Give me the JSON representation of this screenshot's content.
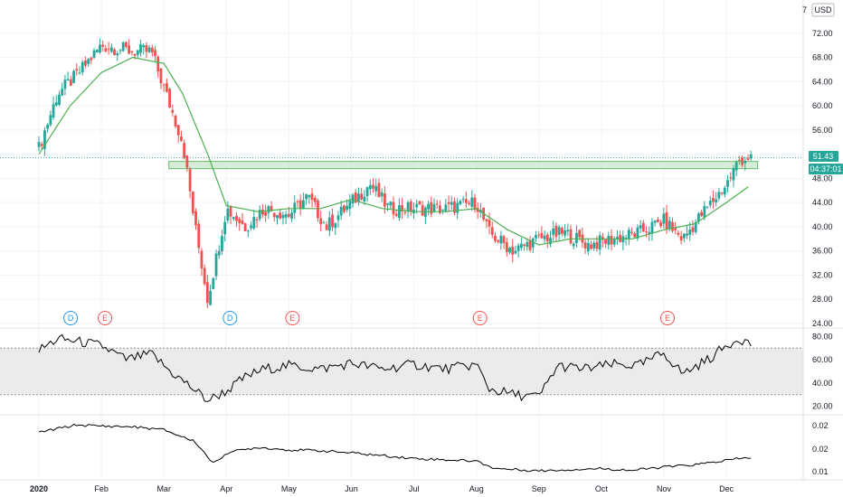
{
  "currency": "USD",
  "price_tags": {
    "last": "51.43",
    "countdown": "04:37:01"
  },
  "colors": {
    "up": "#26a69a",
    "down": "#ef5350",
    "ma": "#4caf50",
    "zone_fill": "#c8e6c9",
    "zone_stroke": "#66bb6a",
    "last_tag": "#26a69a",
    "countdown_tag": "#26a69a",
    "dividend": "#2196f3",
    "earnings": "#ef5350",
    "rsi_band": "#ebebeb",
    "osc_line": "#000000",
    "grid": "#f0f3fa"
  },
  "x_axis_labels": [
    "2020",
    "Feb",
    "Mar",
    "Apr",
    "May",
    "Jun",
    "Jul",
    "Aug",
    "Sep",
    "Oct",
    "Nov",
    "Dec"
  ],
  "events": [
    {
      "label": "D",
      "kind": "dividend",
      "month": 0.45
    },
    {
      "label": "E",
      "kind": "earnings",
      "month": 1.0
    },
    {
      "label": "D",
      "kind": "dividend",
      "month": 3.0
    },
    {
      "label": "E",
      "kind": "earnings",
      "month": 4.0
    },
    {
      "label": "E",
      "kind": "earnings",
      "month": 7.0
    },
    {
      "label": "E",
      "kind": "earnings",
      "month": 10.0
    }
  ],
  "chart_data": [
    {
      "type": "candlestick",
      "pane": "price",
      "ylim": [
        24,
        76
      ],
      "y_ticks": [
        "72.00",
        "68.00",
        "64.00",
        "60.00",
        "56.00",
        "52.00",
        "48.00",
        "44.00",
        "40.00",
        "36.00",
        "32.00",
        "28.00",
        "24.00"
      ],
      "resistance_zone": [
        49.6,
        50.8
      ],
      "last_price": 51.43,
      "moving_average_anchors": [
        [
          0,
          52
        ],
        [
          0.5,
          60
        ],
        [
          1,
          65.5
        ],
        [
          1.5,
          68
        ],
        [
          2,
          67
        ],
        [
          2.3,
          62
        ],
        [
          2.7,
          52
        ],
        [
          3,
          43.5
        ],
        [
          3.5,
          42.5
        ],
        [
          4,
          43
        ],
        [
          4.5,
          43
        ],
        [
          5,
          44.5
        ],
        [
          5.5,
          43
        ],
        [
          6,
          42.5
        ],
        [
          6.5,
          42.5
        ],
        [
          7,
          43
        ],
        [
          7.5,
          39.5
        ],
        [
          8,
          37
        ],
        [
          8.5,
          38
        ],
        [
          9,
          38
        ],
        [
          9.5,
          38
        ],
        [
          10,
          39.5
        ],
        [
          10.5,
          40.5
        ],
        [
          11,
          44
        ],
        [
          11.4,
          47
        ]
      ],
      "close_anchors": [
        [
          0,
          53
        ],
        [
          0.3,
          62
        ],
        [
          0.6,
          65
        ],
        [
          1,
          70
        ],
        [
          1.5,
          69
        ],
        [
          1.8,
          69
        ],
        [
          2.1,
          60
        ],
        [
          2.3,
          54
        ],
        [
          2.5,
          40
        ],
        [
          2.7,
          28
        ],
        [
          2.9,
          38
        ],
        [
          3,
          43
        ],
        [
          3.3,
          40
        ],
        [
          3.6,
          43
        ],
        [
          4,
          42
        ],
        [
          4.3,
          45
        ],
        [
          4.6,
          40
        ],
        [
          5,
          44
        ],
        [
          5.3,
          47
        ],
        [
          5.6,
          43
        ],
        [
          6,
          43
        ],
        [
          6.5,
          43
        ],
        [
          7,
          44
        ],
        [
          7.2,
          39
        ],
        [
          7.6,
          36
        ],
        [
          8,
          38
        ],
        [
          8.4,
          39
        ],
        [
          8.8,
          37
        ],
        [
          9.2,
          38
        ],
        [
          9.6,
          39
        ],
        [
          10,
          41
        ],
        [
          10.3,
          38
        ],
        [
          10.6,
          42
        ],
        [
          11,
          47
        ],
        [
          11.2,
          51
        ],
        [
          11.35,
          51.4
        ]
      ]
    },
    {
      "type": "line",
      "pane": "rsi",
      "ylim": [
        15,
        85
      ],
      "y_ticks": [
        "80.00",
        "60.00",
        "40.00",
        "20.00"
      ],
      "band": [
        30,
        70
      ],
      "anchors": [
        [
          0,
          68
        ],
        [
          0.3,
          78
        ],
        [
          0.6,
          76
        ],
        [
          1,
          72
        ],
        [
          1.4,
          60
        ],
        [
          1.8,
          65
        ],
        [
          2.1,
          50
        ],
        [
          2.4,
          38
        ],
        [
          2.7,
          25
        ],
        [
          3,
          33
        ],
        [
          3.3,
          45
        ],
        [
          3.6,
          52
        ],
        [
          4,
          55
        ],
        [
          4.5,
          52
        ],
        [
          5,
          57
        ],
        [
          5.5,
          52
        ],
        [
          6,
          56
        ],
        [
          6.5,
          52
        ],
        [
          7,
          56
        ],
        [
          7.2,
          35
        ],
        [
          7.6,
          30
        ],
        [
          8,
          28
        ],
        [
          8.3,
          55
        ],
        [
          8.7,
          52
        ],
        [
          9.2,
          56
        ],
        [
          9.6,
          55
        ],
        [
          10,
          66
        ],
        [
          10.3,
          48
        ],
        [
          10.7,
          60
        ],
        [
          11,
          72
        ],
        [
          11.2,
          79
        ],
        [
          11.4,
          73
        ]
      ]
    },
    {
      "type": "line",
      "pane": "oscillator",
      "ylim": [
        0.008,
        0.0245
      ],
      "y_ticks": [
        "0.02",
        "0.02",
        "0.01"
      ],
      "anchors": [
        [
          0,
          0.0205
        ],
        [
          0.6,
          0.0225
        ],
        [
          1,
          0.0222
        ],
        [
          1.5,
          0.022
        ],
        [
          2,
          0.0212
        ],
        [
          2.5,
          0.018
        ],
        [
          2.8,
          0.012
        ],
        [
          3,
          0.015
        ],
        [
          3.5,
          0.0165
        ],
        [
          4,
          0.0158
        ],
        [
          4.5,
          0.0156
        ],
        [
          5,
          0.015
        ],
        [
          6,
          0.0135
        ],
        [
          7,
          0.0128
        ],
        [
          7.3,
          0.0108
        ],
        [
          8,
          0.0102
        ],
        [
          9,
          0.0108
        ],
        [
          9.5,
          0.0103
        ],
        [
          10,
          0.0112
        ],
        [
          10.5,
          0.0118
        ],
        [
          11,
          0.013
        ],
        [
          11.4,
          0.0138
        ]
      ]
    }
  ]
}
